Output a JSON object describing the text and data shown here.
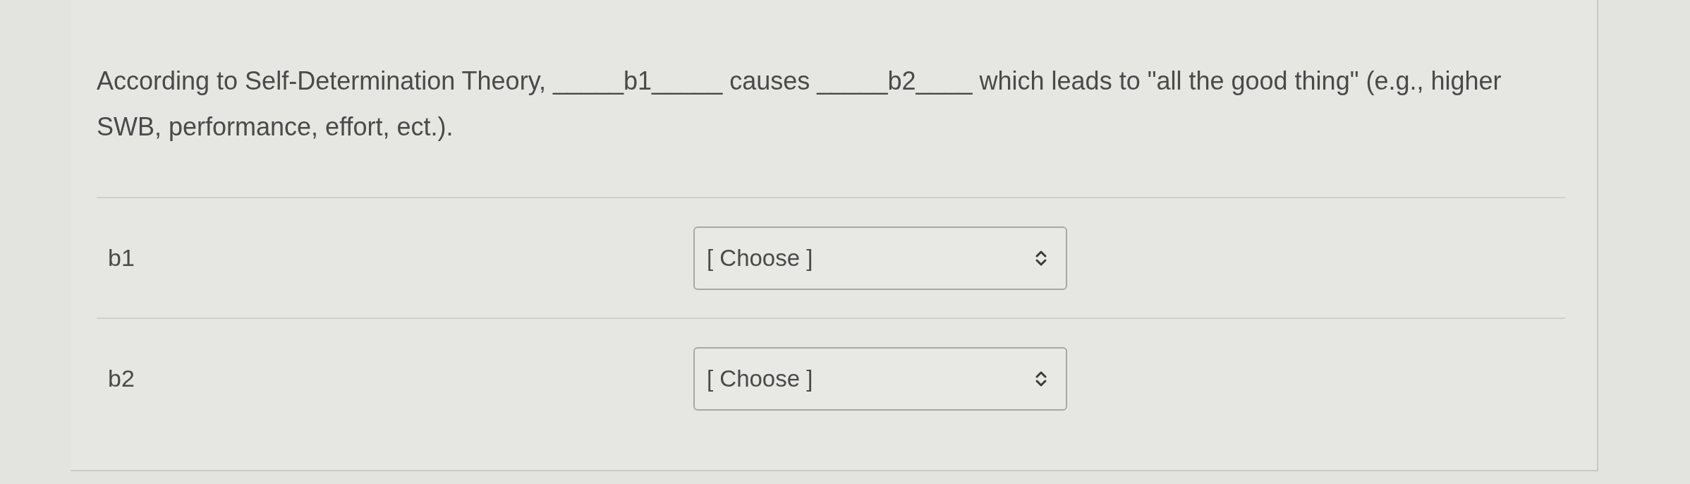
{
  "question": {
    "text": "According to Self-Determination Theory, _____b1_____ causes _____b2____ which leads to \"all the good thing\" (e.g., higher SWB, performance, effort, ect.)."
  },
  "blanks": [
    {
      "label": "b1",
      "select": {
        "value": "[ Choose ]"
      }
    },
    {
      "label": "b2",
      "select": {
        "value": "[ Choose ]"
      }
    }
  ]
}
